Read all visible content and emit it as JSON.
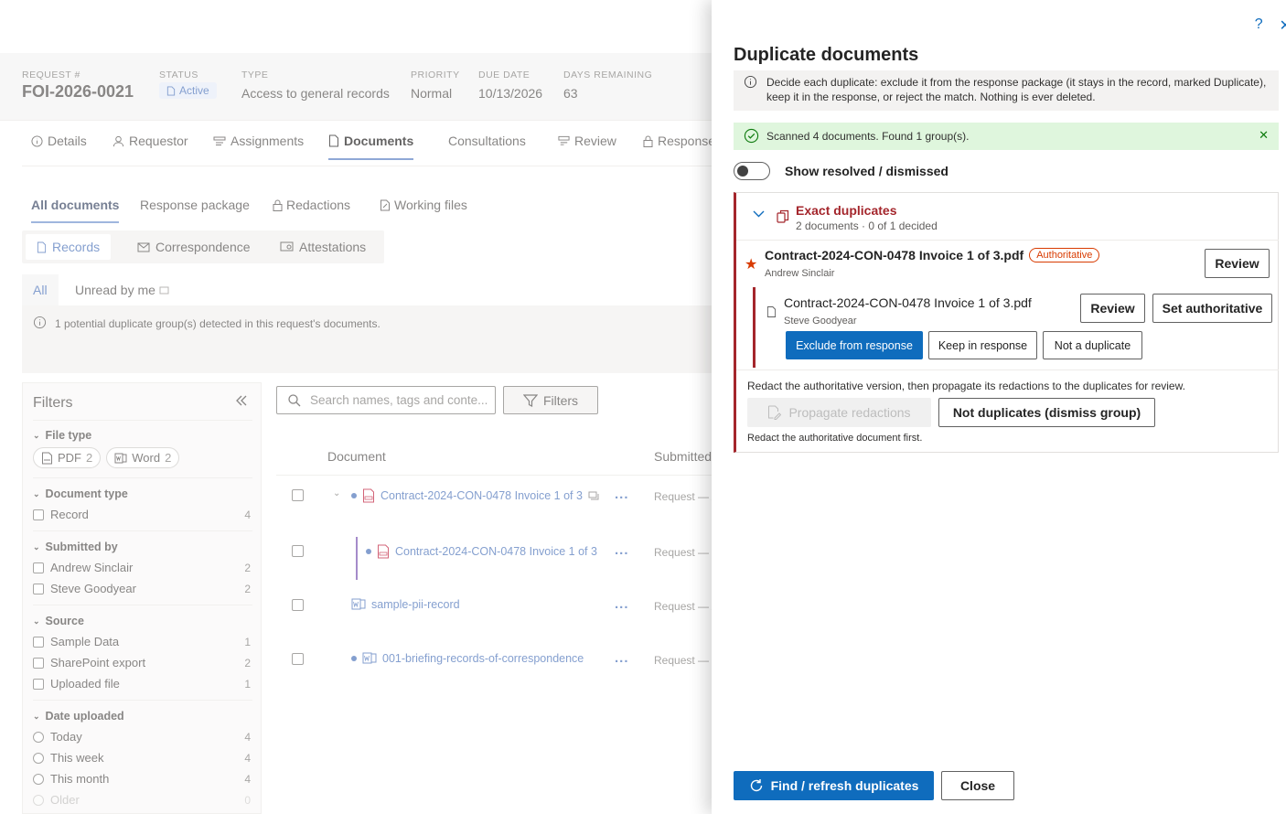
{
  "request": {
    "number_label": "REQUEST #",
    "number": "FOI-2026-0021",
    "status_label": "STATUS",
    "status": "Active",
    "type_label": "TYPE",
    "type": "Access to general records",
    "priority_label": "PRIORITY",
    "priority": "Normal",
    "due_label": "DUE DATE",
    "due": "10/13/2026",
    "days_label": "DAYS REMAINING",
    "days": "63"
  },
  "main_tabs": [
    {
      "label": "Details",
      "icon": "info-icon"
    },
    {
      "label": "Requestor",
      "icon": "person-icon"
    },
    {
      "label": "Assignments",
      "icon": "assign-icon"
    },
    {
      "label": "Documents",
      "icon": "document-icon",
      "active": true
    },
    {
      "label": "Consultations",
      "icon": ""
    },
    {
      "label": "Review",
      "icon": "review-icon"
    },
    {
      "label": "Response",
      "icon": "lock-icon"
    }
  ],
  "doc_tabs": [
    "All documents",
    "Response package",
    "Redactions",
    "Working files"
  ],
  "record_tabs": [
    "Records",
    "Correspondence",
    "Attestations"
  ],
  "read_tabs": [
    "All",
    "Unread by me"
  ],
  "info_banner": "1 potential duplicate group(s) detected in this request's documents.",
  "filters": {
    "title": "Filters",
    "file_type": {
      "label": "File type",
      "chips": [
        {
          "label": "PDF",
          "count": "2"
        },
        {
          "label": "Word",
          "count": "2"
        }
      ]
    },
    "document_type": {
      "label": "Document type",
      "items": [
        {
          "label": "Record",
          "count": "4"
        }
      ]
    },
    "submitted_by": {
      "label": "Submitted by",
      "items": [
        {
          "label": "Andrew Sinclair",
          "count": "2"
        },
        {
          "label": "Steve Goodyear",
          "count": "2"
        }
      ]
    },
    "source": {
      "label": "Source",
      "items": [
        {
          "label": "Sample Data",
          "count": "1"
        },
        {
          "label": "SharePoint export",
          "count": "2"
        },
        {
          "label": "Uploaded file",
          "count": "1"
        }
      ]
    },
    "date_uploaded": {
      "label": "Date uploaded",
      "items": [
        {
          "label": "Today",
          "count": "4"
        },
        {
          "label": "This week",
          "count": "4"
        },
        {
          "label": "This month",
          "count": "4"
        },
        {
          "label": "Older",
          "count": "0"
        }
      ]
    }
  },
  "search": {
    "placeholder": "Search names, tags and conte..."
  },
  "filters_button": "Filters",
  "doc_table": {
    "col_document": "Document",
    "col_submitted": "Submitted",
    "rows": [
      {
        "name": "Contract-2024-CON-0478 Invoice 1 of 3",
        "submitted": "Request — A"
      },
      {
        "name": "Contract-2024-CON-0478 Invoice 1 of 3",
        "submitted": "Request — S"
      },
      {
        "name": "sample-pii-record",
        "submitted": "Request — A"
      },
      {
        "name": "001-briefing-records-of-correspondence",
        "submitted": "Request — S"
      }
    ],
    "more": "..."
  },
  "panel": {
    "title": "Duplicate documents",
    "description": "Decide each duplicate: exclude it from the response package (it stays in the record, marked Duplicate), keep it in the response, or reject the match. Nothing is ever deleted.",
    "scan_result": "Scanned 4 documents. Found 1 group(s).",
    "toggle_label": "Show resolved / dismissed",
    "group": {
      "title": "Exact duplicates",
      "subtitle": "2 documents · 0 of 1 decided",
      "authoritative": {
        "name": "Contract-2024-CON-0478 Invoice 1 of 3.pdf",
        "badge": "Authoritative",
        "by": "Andrew Sinclair",
        "review": "Review"
      },
      "duplicate": {
        "name": "Contract-2024-CON-0478 Invoice 1 of 3.pdf",
        "by": "Steve Goodyear",
        "review": "Review",
        "set_authoritative": "Set authoritative",
        "exclude": "Exclude from response",
        "keep": "Keep in response",
        "not_dup": "Not a duplicate"
      },
      "propagate_note": "Redact the authoritative version, then propagate its redactions to the duplicates for review.",
      "propagate_button": "Propagate redactions",
      "dismiss_button": "Not duplicates (dismiss group)",
      "redact_first": "Redact the authoritative document first."
    },
    "find_button": "Find / refresh duplicates",
    "close_button": "Close",
    "help": "?",
    "close_x": "✕"
  },
  "colors": {
    "accent": "#0f6cbd",
    "danger": "#a4262c",
    "warning": "#d83b01",
    "success_bg": "#dff6dd"
  }
}
